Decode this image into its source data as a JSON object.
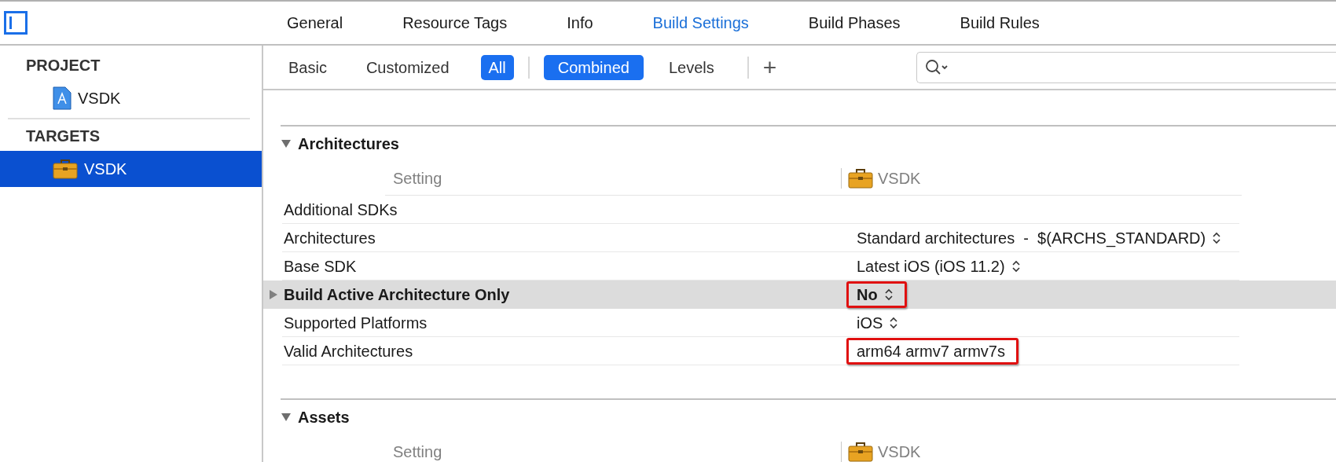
{
  "tabs": [
    {
      "label": "General",
      "selected": false
    },
    {
      "label": "Resource Tags",
      "selected": false
    },
    {
      "label": "Info",
      "selected": false
    },
    {
      "label": "Build Settings",
      "selected": true
    },
    {
      "label": "Build Phases",
      "selected": false
    },
    {
      "label": "Build Rules",
      "selected": false
    }
  ],
  "sidebar": {
    "sections": [
      {
        "title": "PROJECT",
        "items": [
          {
            "label": "VSDK",
            "kind": "project",
            "selected": false
          }
        ]
      },
      {
        "title": "TARGETS",
        "items": [
          {
            "label": "VSDK",
            "kind": "target",
            "selected": true
          }
        ]
      }
    ]
  },
  "filters": {
    "scope": [
      {
        "label": "Basic",
        "selected": false
      },
      {
        "label": "Customized",
        "selected": false
      },
      {
        "label": "All",
        "selected": true
      }
    ],
    "view": [
      {
        "label": "Combined",
        "selected": true
      },
      {
        "label": "Levels",
        "selected": false
      }
    ],
    "add": "+"
  },
  "sections": [
    {
      "title": "Architectures",
      "expanded": true,
      "column_setting": "Setting",
      "column_target": "VSDK",
      "rows": [
        {
          "name": "Additional SDKs",
          "value": "",
          "popup": false,
          "selected": false,
          "expandable": false,
          "highlighted": false
        },
        {
          "name": "Architectures",
          "value": "Standard architectures  -  $(ARCHS_STANDARD)",
          "popup": true,
          "selected": false,
          "expandable": false,
          "highlighted": false
        },
        {
          "name": "Base SDK",
          "value": "Latest iOS (iOS 11.2)",
          "popup": true,
          "selected": false,
          "expandable": false,
          "highlighted": false
        },
        {
          "name": "Build Active Architecture Only",
          "value": "No",
          "popup": true,
          "selected": true,
          "expandable": true,
          "highlighted": true
        },
        {
          "name": "Supported Platforms",
          "value": "iOS",
          "popup": true,
          "selected": false,
          "expandable": false,
          "highlighted": false
        },
        {
          "name": "Valid Architectures",
          "value": "arm64 armv7 armv7s",
          "popup": false,
          "selected": false,
          "expandable": false,
          "highlighted": true
        }
      ]
    },
    {
      "title": "Assets",
      "expanded": true,
      "column_setting": "Setting",
      "column_target": "VSDK"
    }
  ]
}
